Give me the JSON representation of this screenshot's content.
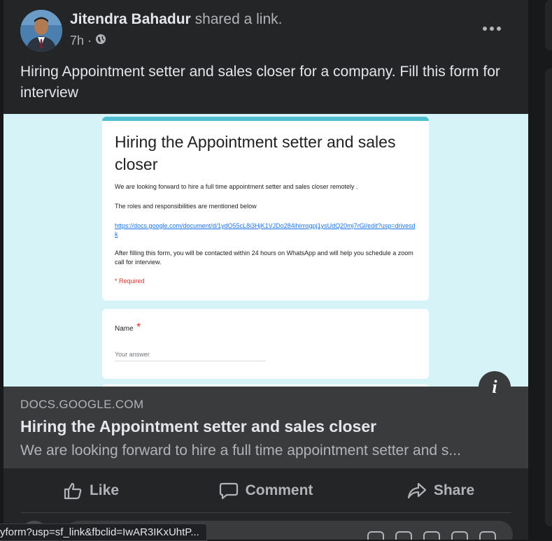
{
  "post": {
    "author_name": "Jitendra Bahadur",
    "author_action": "shared a link.",
    "time": "7h",
    "separator": "·",
    "text": "Hiring Appointment setter and sales closer for a company. Fill this form for interview"
  },
  "preview": {
    "form_title": "Hiring the Appointment setter and sales closer",
    "form_intro": "We are looking forward to hire a full time appointment setter and sales closer remotely .",
    "form_roles": "The roles and responsibilities are mentioned below",
    "form_link": "https://docs.google.com/document/d/1ydO55cL8i3HjK1VJDo284ihimsgpj1ysUdQ20mj7rGl/edit?usp=drivesdk",
    "form_followup": "After filling this form, you will be contacted within 24 hours on WhatsApp and will help you schedule a zoom call for interview.",
    "form_required": "* Required",
    "question_label": "Name",
    "question_star": "*",
    "answer_placeholder": "Your answer"
  },
  "link": {
    "domain": "DOCS.GOOGLE.COM",
    "title": "Hiring the Appointment setter and sales closer",
    "description": "We are looking forward to hire a full time appointment setter and s..."
  },
  "actions": {
    "like": "Like",
    "comment": "Comment",
    "share": "Share"
  },
  "status_bar": {
    "url": "yform?usp=sf_link&fbclid=IwAR3IKxUhtP..."
  },
  "colors": {
    "background": "#18191a",
    "card": "#242526",
    "accent_form": "#4fc0d0"
  },
  "icons": [
    "globe-icon",
    "more-icon",
    "info-icon",
    "like-icon",
    "comment-icon",
    "share-icon"
  ]
}
